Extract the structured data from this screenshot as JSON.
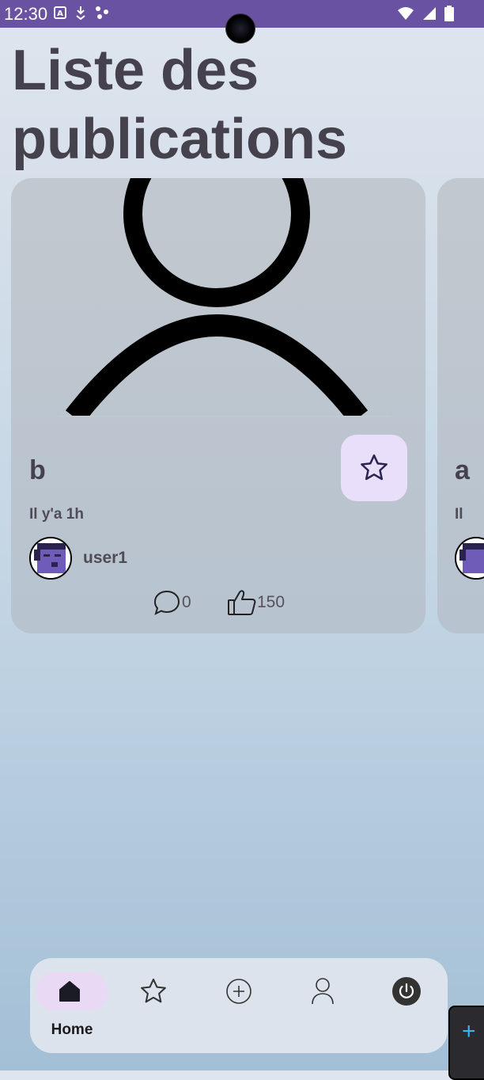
{
  "status_bar": {
    "time": "12:30",
    "left_icons": [
      "text-badge-icon",
      "download-icon",
      "dots-icon"
    ],
    "right_icons": [
      "wifi-icon",
      "signal-icon",
      "battery-icon"
    ],
    "color": "#6a52a3"
  },
  "page": {
    "title": "Liste des publications"
  },
  "posts": [
    {
      "title": "b",
      "time": "Il y'a 1h",
      "author": "user1",
      "comments": "0",
      "likes": "150",
      "image_icon": "person-placeholder-icon",
      "favorite_icon": "star-outline-icon"
    },
    {
      "title": "a",
      "time": "Il"
    }
  ],
  "bottom_nav": {
    "items": [
      {
        "label": "Home",
        "icon": "home-icon",
        "active": true
      },
      {
        "label": "",
        "icon": "star-icon",
        "active": false
      },
      {
        "label": "",
        "icon": "add-circle-icon",
        "active": false
      },
      {
        "label": "",
        "icon": "profile-icon",
        "active": false
      },
      {
        "label": "",
        "icon": "power-icon",
        "active": false
      }
    ]
  },
  "fab": {
    "label": "+"
  },
  "colors": {
    "accent": "#6a52a3",
    "pill": "#ead9f5",
    "favorite_bg": "#eadffa",
    "text": "#45424d"
  }
}
